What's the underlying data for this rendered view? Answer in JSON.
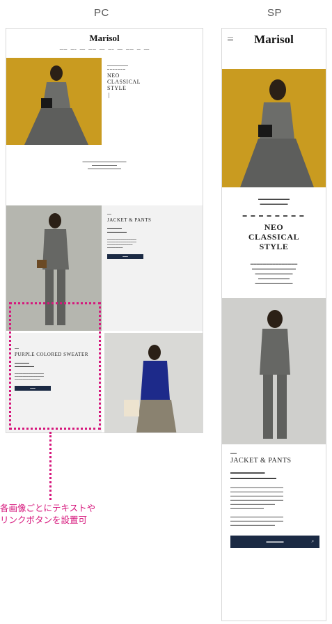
{
  "labels": {
    "pc": "PC",
    "sp": "SP"
  },
  "annotation": {
    "line1": "各画像ごとにテキストや",
    "line2": "リンクボタンを設置可"
  },
  "accent": "#d6177c",
  "pc": {
    "logo": "Marisol",
    "hero_title": [
      "NEO",
      "CLASSICAL",
      "STYLE"
    ],
    "sec1_title": "JACKET & PANTS",
    "sec2_title": "PURPLE COLORED SWEATER"
  },
  "sp": {
    "logo": "Marisol",
    "hero_title": [
      "NEO",
      "CLASSICAL",
      "STYLE"
    ],
    "sec_title": "JACKET & PANTS"
  }
}
